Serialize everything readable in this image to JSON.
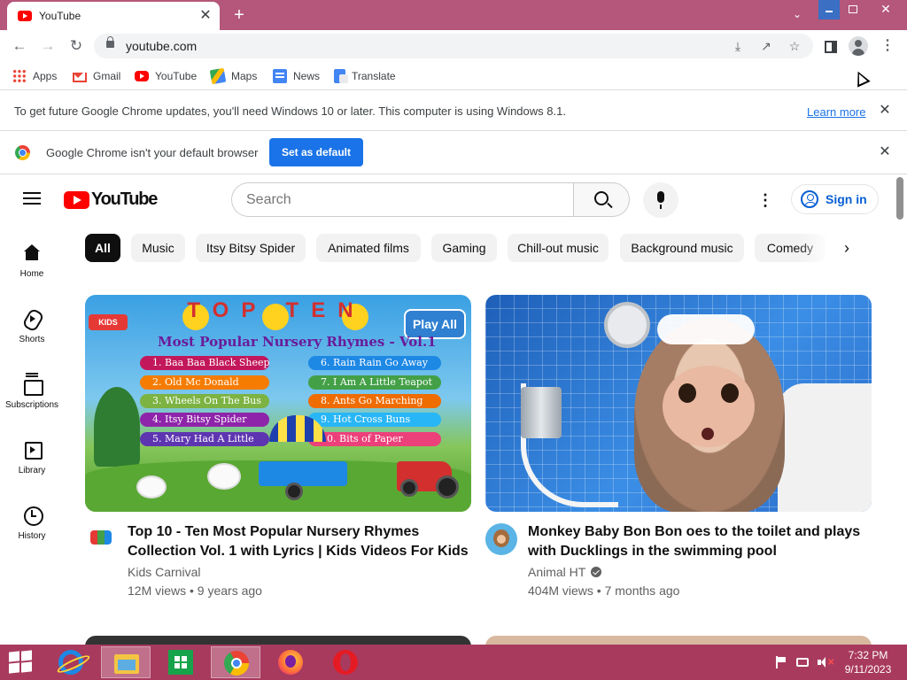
{
  "browser": {
    "tab_title": "YouTube",
    "tab_close_label": "✕",
    "new_tab_label": "+",
    "url": "youtube.com",
    "bookmarks": [
      {
        "label": "Apps",
        "icon": "apps-icon"
      },
      {
        "label": "Gmail",
        "icon": "gmail-icon"
      },
      {
        "label": "YouTube",
        "icon": "youtube-icon"
      },
      {
        "label": "Maps",
        "icon": "maps-icon"
      },
      {
        "label": "News",
        "icon": "news-icon"
      },
      {
        "label": "Translate",
        "icon": "translate-icon"
      }
    ],
    "update_bar": {
      "text": "To get future Google Chrome updates, you'll need Windows 10 or later. This computer is using Windows 8.1.",
      "link": "Learn more"
    },
    "default_bar": {
      "text": "Google Chrome isn't your default browser",
      "button": "Set as default"
    }
  },
  "youtube": {
    "logo_text": "YouTube",
    "search_placeholder": "Search",
    "sign_in": "Sign in",
    "chips": [
      "All",
      "Music",
      "Itsy Bitsy Spider",
      "Animated films",
      "Gaming",
      "Chill-out music",
      "Background music",
      "Comedy"
    ],
    "guide": [
      {
        "label": "Home",
        "icon": "home-icon"
      },
      {
        "label": "Shorts",
        "icon": "shorts-icon"
      },
      {
        "label": "Subscriptions",
        "icon": "subscriptions-icon"
      },
      {
        "label": "Library",
        "icon": "library-icon"
      },
      {
        "label": "History",
        "icon": "history-icon"
      }
    ],
    "videos": [
      {
        "title": "Top 10 - Ten Most Popular Nursery Rhymes Collection Vol. 1 with Lyrics | Kids Videos For Kids",
        "channel": "Kids Carnival",
        "verified": false,
        "stats": "12M views • 9 years ago",
        "thumbnail_text": {
          "banner": "TOP TEN",
          "subtitle": "Most Popular Nursery Rhymes - Vol.1",
          "play_all": "Play All",
          "kids": "KIDS",
          "rhymes": [
            "1. Baa Baa Black Sheep",
            "2. Old Mc Donald",
            "3. Wheels On The Bus",
            "4. Itsy Bitsy Spider",
            "5. Mary Had A Little",
            "6. Rain Rain Go Away",
            "7. I Am A Little Teapot",
            "8. Ants Go Marching",
            "9. Hot Cross Buns",
            "10. Bits of Paper"
          ]
        }
      },
      {
        "title": "Monkey Baby Bon Bon oes to the toilet and plays with Ducklings in the swimming pool",
        "channel": "Animal HT",
        "verified": true,
        "stats": "404M views • 7 months ago"
      }
    ]
  },
  "taskbar": {
    "apps": [
      "internet-explorer-icon",
      "file-explorer-icon",
      "store-icon",
      "chrome-icon",
      "firefox-icon",
      "opera-icon"
    ],
    "time": "7:32 PM",
    "date": "9/11/2023"
  },
  "colors": {
    "titlebar": "#b4577a",
    "taskbar": "#a83a5e",
    "yt_red": "#ff0000",
    "chrome_blue": "#1a73e8"
  }
}
